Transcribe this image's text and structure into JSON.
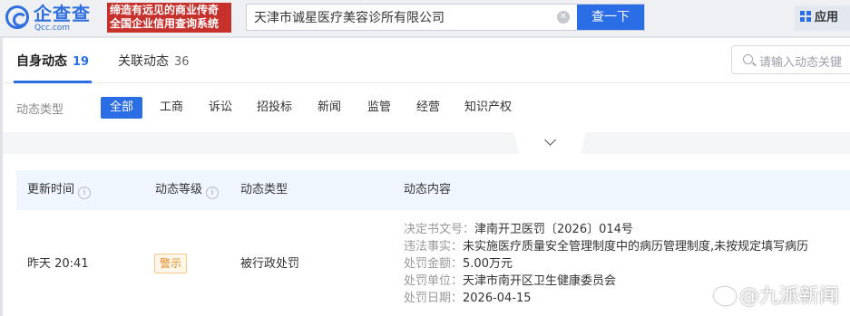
{
  "header": {
    "logo_text": "企查查",
    "logo_sub": "Qcc.com",
    "slogan_line1": "缔造有远见的商业传奇",
    "slogan_line2": "全国企业信用查询系统",
    "search_value": "天津市诚星医疗美容诊所有限公司",
    "search_button": "查一下",
    "app_label": "应用"
  },
  "tabs": [
    {
      "label": "自身动态",
      "count": "19",
      "active": true
    },
    {
      "label": "关联动态",
      "count": "36",
      "active": false
    }
  ],
  "dynamic_search_placeholder": "请输入动态关键",
  "filter": {
    "label": "动态类型",
    "options": [
      "全部",
      "工商",
      "诉讼",
      "招投标",
      "新闻",
      "监管",
      "经营",
      "知识产权"
    ],
    "selected": "全部"
  },
  "table": {
    "headers": [
      "更新时间",
      "动态等级",
      "动态类型",
      "动态内容"
    ],
    "rows": [
      {
        "time": "昨天 20:41",
        "level": "警示",
        "type": "被行政处罚",
        "details": [
          {
            "key": "决定书文号：",
            "value": "津南开卫医罚〔2026〕014号"
          },
          {
            "key": "违法事实：",
            "value": "未实施医疗质量安全管理制度中的病历管理制度,未按规定填写病历"
          },
          {
            "key": "处罚金额：",
            "value": "5.00万元"
          },
          {
            "key": "处罚单位：",
            "value": "天津市南开区卫生健康委员会"
          },
          {
            "key": "处罚日期：",
            "value": "2026-04-15"
          }
        ]
      }
    ]
  },
  "watermark": "@九派新闻",
  "colors": {
    "accent": "#2b6de5",
    "slogan_bg": "#c7312b",
    "warn": "#e08a1e"
  }
}
